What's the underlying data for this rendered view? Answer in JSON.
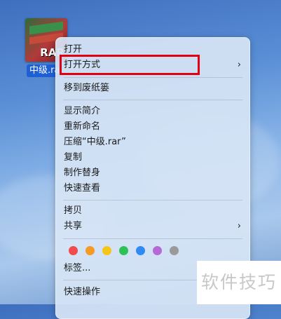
{
  "desktop": {
    "file": {
      "icon": "rar-archive-icon",
      "icon_text": "RAR",
      "label": "中级.ra"
    }
  },
  "context_menu": {
    "open": "打开",
    "open_with": "打开方式",
    "move_to_trash": "移到废纸篓",
    "get_info": "显示简介",
    "rename": "重新命名",
    "compress": "压缩“中级.rar”",
    "duplicate": "复制",
    "make_alias": "制作替身",
    "quick_look": "快速查看",
    "copy": "拷贝",
    "share": "共享",
    "tags": "标签...",
    "quick_actions": "快速操作",
    "tag_colors": [
      "#f24b4b",
      "#f59a23",
      "#f5c518",
      "#2ec254",
      "#2f8af5",
      "#b56ad6",
      "#9a9a9a"
    ],
    "submenu_arrow": "›"
  },
  "watermark": "软件技巧"
}
